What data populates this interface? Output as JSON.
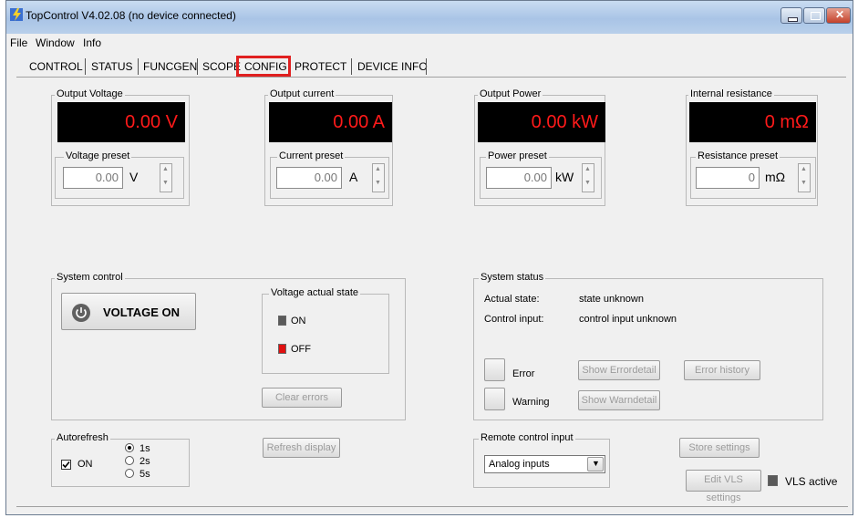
{
  "window": {
    "title": "TopControl V4.02.08 (no device connected)"
  },
  "menu": [
    "File",
    "Window",
    "Info"
  ],
  "tabs": [
    "CONTROL",
    "STATUS",
    "FUNCGEN",
    "SCOPE",
    "CONFIG",
    "PROTECT",
    "DEVICE INFO"
  ],
  "colors": {
    "display_bg": "#000000",
    "display_text": "#ff1a1a",
    "highlight": "#e02020",
    "led_on": "#5a5a5a",
    "led_off": "#e01010"
  },
  "voltage": {
    "title": "Output Voltage",
    "display": "0.00 V",
    "preset_label": "Voltage preset",
    "preset_value": "0.00",
    "unit": "V"
  },
  "current": {
    "title": "Output current",
    "display": "0.00 A",
    "preset_label": "Current preset",
    "preset_value": "0.00",
    "unit": "A"
  },
  "power": {
    "title": "Output Power",
    "display": "0.00 kW",
    "preset_label": "Power preset",
    "preset_value": "0.00",
    "unit": "kW"
  },
  "resistance": {
    "title": "Internal resistance",
    "display": "0 mΩ",
    "preset_label": "Resistance preset",
    "preset_value": "0",
    "unit": "mΩ"
  },
  "system_control": {
    "title": "System control",
    "voltage_button": "VOLTAGE ON",
    "actual_state_title": "Voltage actual state",
    "on_label": "ON",
    "off_label": "OFF",
    "clear_errors": "Clear errors"
  },
  "system_status": {
    "title": "System status",
    "actual_state_label": "Actual state:",
    "actual_state_value": "state unknown",
    "control_input_label": "Control input:",
    "control_input_value": "control input unknown",
    "error_label": "Error",
    "warning_label": "Warning",
    "show_errordetail": "Show Errordetail",
    "error_history": "Error history",
    "show_warndetail": "Show Warndetail"
  },
  "autorefresh": {
    "title": "Autorefresh",
    "checkbox_label": "ON",
    "options": [
      "1s",
      "2s",
      "5s"
    ],
    "selected": "1s"
  },
  "refresh_display": "Refresh display",
  "remote": {
    "title": "Remote control input",
    "selected": "Analog inputs"
  },
  "store_settings": "Store settings",
  "edit_vls": "Edit VLS settings",
  "vls_active": "VLS active"
}
